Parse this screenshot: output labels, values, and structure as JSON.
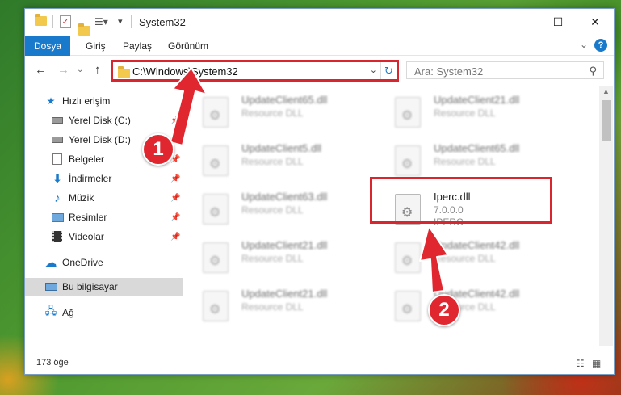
{
  "window": {
    "title": "System32"
  },
  "ribbon": {
    "tabs": [
      {
        "label": "Dosya",
        "active": true
      },
      {
        "label": "Giriş"
      },
      {
        "label": "Paylaş"
      },
      {
        "label": "Görünüm"
      }
    ]
  },
  "nav": {
    "address": "C:\\Windows\\System32",
    "search_placeholder": "Ara: System32"
  },
  "sidebar": {
    "items": [
      {
        "label": "Hızlı erişim",
        "icon": "star-icon"
      },
      {
        "label": "Yerel Disk (C:)",
        "icon": "drive-icon",
        "pinned": true
      },
      {
        "label": "Yerel Disk (D:)",
        "icon": "drive-icon",
        "pinned": true
      },
      {
        "label": "Belgeler",
        "icon": "documents-icon",
        "pinned": true
      },
      {
        "label": "İndirmeler",
        "icon": "download-icon",
        "pinned": true
      },
      {
        "label": "Müzik",
        "icon": "music-icon",
        "pinned": true
      },
      {
        "label": "Resimler",
        "icon": "pictures-icon",
        "pinned": true
      },
      {
        "label": "Videolar",
        "icon": "videos-icon",
        "pinned": true
      },
      {
        "label": "OneDrive",
        "icon": "cloud-icon"
      },
      {
        "label": "Bu bilgisayar",
        "icon": "computer-icon",
        "selected": true
      },
      {
        "label": "Ağ",
        "icon": "network-icon"
      }
    ]
  },
  "files": [
    {
      "name": "UpdateClient65.dll",
      "type": "Resource DLL"
    },
    {
      "name": "UpdateClient21.dll",
      "type": "Resource DLL"
    },
    {
      "name": "UpdateClient5.dll",
      "type": "Resource DLL"
    },
    {
      "name": "UpdateClient65.dll",
      "type": "Resource DLL"
    },
    {
      "name": "UpdateClient63.dll",
      "type": "Resource DLL"
    },
    {
      "name": "Iperc.dll",
      "version": "7.0.0.0",
      "company": "IPERC"
    },
    {
      "name": "UpdateClient21.dll",
      "type": "Resource DLL"
    },
    {
      "name": "UpdateClient42.dll",
      "type": "Resource DLL"
    },
    {
      "name": "UpdateClient21.dll",
      "type": "Resource DLL"
    },
    {
      "name": "UpdateClient42.dll",
      "type": "Resource DLL"
    }
  ],
  "status": {
    "count": "173 öğe"
  },
  "annotations": {
    "badge1": "1",
    "badge2": "2",
    "color": "#e0262e"
  }
}
